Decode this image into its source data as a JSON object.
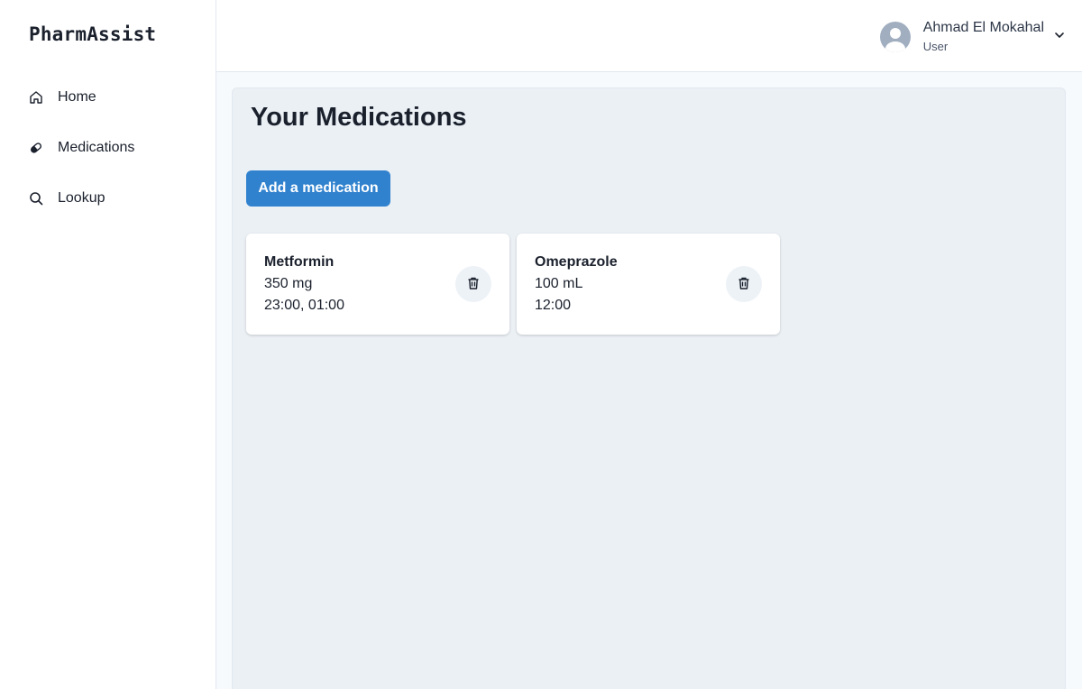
{
  "app": {
    "brand": "PharmAssist"
  },
  "sidebar": {
    "items": [
      {
        "label": "Home",
        "icon": "home-icon"
      },
      {
        "label": "Medications",
        "icon": "pill-icon"
      },
      {
        "label": "Lookup",
        "icon": "search-icon"
      }
    ]
  },
  "header": {
    "user": {
      "name": "Ahmad El Mokahal",
      "role": "User",
      "avatar_icon": "user-avatar-icon",
      "menu_icon": "chevron-down-icon"
    }
  },
  "main": {
    "title": "Your Medications",
    "add_button_label": "Add a medication",
    "medications": [
      {
        "name": "Metformin",
        "dose": "350 mg",
        "times": "23:00, 01:00",
        "delete_icon": "trash-icon"
      },
      {
        "name": "Omeprazole",
        "dose": "100 mL",
        "times": "12:00",
        "delete_icon": "trash-icon"
      }
    ]
  },
  "colors": {
    "accent": "#3182ce",
    "panel_background": "#ebf0f5",
    "text": "#1a202c"
  }
}
